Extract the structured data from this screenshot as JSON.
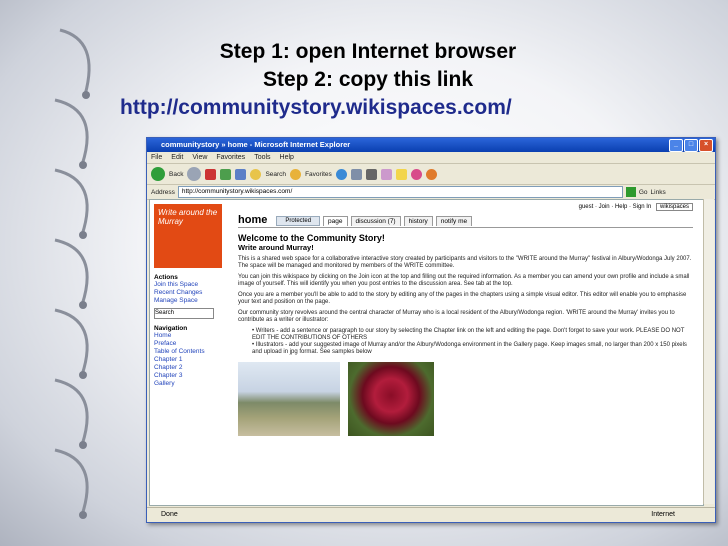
{
  "slide": {
    "step1": "Step 1: open Internet browser",
    "step2": "Step 2: copy this link",
    "link": "http://communitystory.wikispaces.com/"
  },
  "browser": {
    "title": "communitystory » home - Microsoft Internet Explorer",
    "menu": [
      "File",
      "Edit",
      "View",
      "Favorites",
      "Tools",
      "Help"
    ],
    "toolbar": {
      "back": "Back",
      "search": "Search",
      "favorites": "Favorites"
    },
    "address_label": "Address",
    "address": "http://communitystory.wikispaces.com/",
    "go": "Go",
    "links": "Links",
    "status_left": "Done",
    "status_right": "Internet"
  },
  "page": {
    "banner_text": "Write around the Murray",
    "actions_head": "Actions",
    "actions": [
      "Join this Space",
      "Recent Changes",
      "Manage Space"
    ],
    "search_placeholder": "Search",
    "nav_head": "Navigation",
    "nav": [
      "Home",
      "Preface",
      "Table of Contents",
      "Chapter 1",
      "Chapter 2",
      "Chapter 3",
      "Gallery"
    ],
    "util_links": "guest · Join · Help · Sign In",
    "util_badge": "wikispaces",
    "home": "home",
    "protected": "Protected",
    "tabs": [
      "page",
      "discussion (7)",
      "history",
      "notify me"
    ],
    "title": "Welcome to the Community Story!",
    "subtitle": "Write around Murray!",
    "p1": "This is a shared web space for a collaborative interactive story created by participants and visitors to the \"WRITE around the Murray\" festival in Albury/Wodonga July 2007. The space will be managed and monitored by members of the WRITE committee.",
    "p2": "You can join this wikispace by clicking on the Join icon at the top and filling out the required information. As a member you can amend your own profile and include a small image of yourself. This will identify you when you post entries to the discussion area. See tab at the top.",
    "p3": "Once you are a member you'll be able to add to the story by editing any of the pages in the chapters using a simple visual editor. This editor will enable you to emphasise your text and position on the page.",
    "p4": "Our community story revolves around the central character of Murray who is a local resident of the Albury/Wodonga region. 'WRITE around the Murray' invites you to contribute as a writer or illustrator:",
    "b1": "Writers - add a sentence or paragraph to our story by selecting the Chapter link on the left and editing the page. Don't forget to save your work. PLEASE DO NOT EDIT THE CONTRIBUTIONS OF OTHERS",
    "b2": "Illustrators - add your suggested image of Murray and/or the Albury/Wodonga environment in the Gallery page. Keep images small, no larger than 200 x 150 pixels and upload in jpg format. See samples below"
  },
  "colors": {
    "titlebar": "#0a3fb0",
    "link": "#1f2b8c",
    "banner": "#e24a14"
  }
}
